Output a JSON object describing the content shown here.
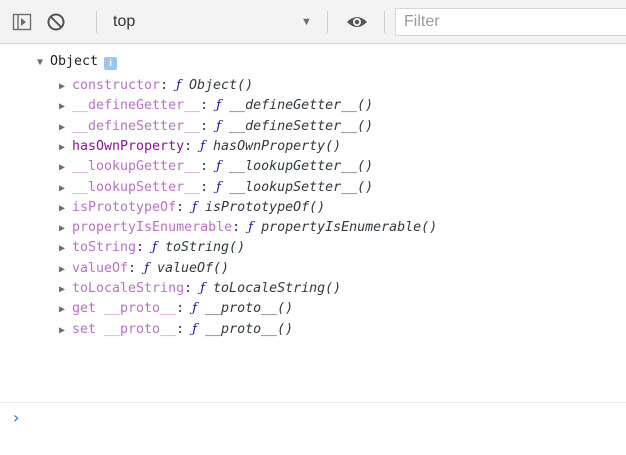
{
  "toolbar": {
    "context": "top",
    "filter_placeholder": "Filter",
    "icons": [
      "sidebar-toggle-icon",
      "clear-console-icon",
      "dropdown-arrow-icon",
      "live-expression-eye-icon"
    ]
  },
  "object": {
    "title": "Object",
    "badge": "i",
    "properties": [
      {
        "key": "constructor",
        "sep": ":",
        "glyph": "ƒ",
        "sig": "Object()"
      },
      {
        "key": "__defineGetter__",
        "sep": ":",
        "glyph": "ƒ",
        "sig": "__defineGetter__()"
      },
      {
        "key": "__defineSetter__",
        "sep": ":",
        "glyph": "ƒ",
        "sig": "__defineSetter__()"
      },
      {
        "key": "hasOwnProperty",
        "sep": ":",
        "glyph": "ƒ",
        "sig": "hasOwnProperty()"
      },
      {
        "key": "__lookupGetter__",
        "sep": ":",
        "glyph": "ƒ",
        "sig": "__lookupGetter__()"
      },
      {
        "key": "__lookupSetter__",
        "sep": ":",
        "glyph": "ƒ",
        "sig": "__lookupSetter__()"
      },
      {
        "key": "isPrototypeOf",
        "sep": ":",
        "glyph": "ƒ",
        "sig": "isPrototypeOf()"
      },
      {
        "key": "propertyIsEnumerable",
        "sep": ":",
        "glyph": "ƒ",
        "sig": "propertyIsEnumerable()"
      },
      {
        "key": "toString",
        "sep": ":",
        "glyph": "ƒ",
        "sig": "toString()"
      },
      {
        "key": "valueOf",
        "sep": ":",
        "glyph": "ƒ",
        "sig": "valueOf()"
      },
      {
        "key": "toLocaleString",
        "sep": ":",
        "glyph": "ƒ",
        "sig": "toLocaleString()"
      },
      {
        "key": "get __proto__",
        "sep": ":",
        "glyph": "ƒ",
        "sig": "__proto__()"
      },
      {
        "key": "set __proto__",
        "sep": ":",
        "glyph": "ƒ",
        "sig": "__proto__()"
      }
    ]
  },
  "prompt": "›",
  "colors": {
    "key": "#881391",
    "key_dim": "#b971c8",
    "function_glyph": "#1a1aa6",
    "prompt": "#1a73e8",
    "toolbar_bg": "#f3f3f3"
  }
}
